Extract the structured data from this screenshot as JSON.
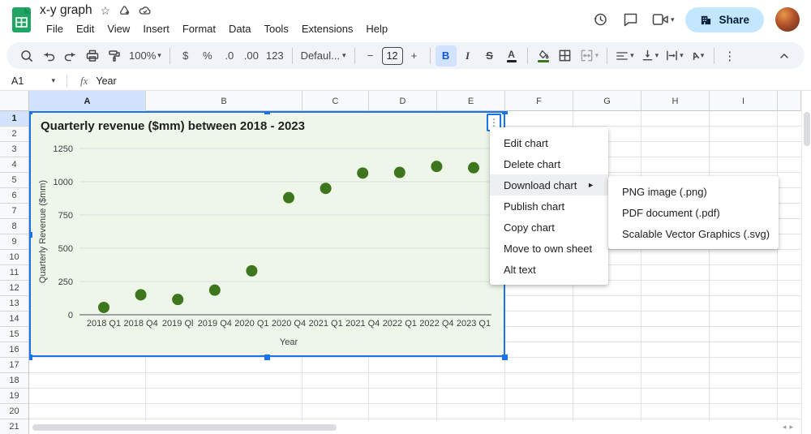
{
  "titlebar": {
    "title": "x-y graph",
    "menus": [
      "File",
      "Edit",
      "View",
      "Insert",
      "Format",
      "Data",
      "Tools",
      "Extensions",
      "Help"
    ],
    "share_label": "Share"
  },
  "toolbar": {
    "zoom": "100%",
    "currency": "$",
    "percent": "%",
    "decrease_decimal": ".0",
    "increase_decimal": ".00",
    "more_formats": "123",
    "font": "Defaul...",
    "font_size": "12",
    "decrease_font": "−",
    "increase_font": "+",
    "bold": "B",
    "italic": "I",
    "strikethrough": "S",
    "text_color": "A",
    "text_rotation": "A",
    "more": "⋮"
  },
  "formula_bar": {
    "name_box": "A1",
    "fx": "fx",
    "value": "Year"
  },
  "grid": {
    "columns": [
      "A",
      "B",
      "C",
      "D",
      "E",
      "F",
      "G",
      "H",
      "I"
    ],
    "selected_column": "A",
    "row_count": 21,
    "selected_row": "1"
  },
  "chart_data": {
    "type": "scatter",
    "title": "Quarterly revenue ($mm) between 2018 - 2023",
    "xlabel": "Year",
    "ylabel": "Quarterly Revenue ($mm)",
    "categories": [
      "2018 Q1",
      "2018 Q4",
      "2019 Ql",
      "2019 Q4",
      "2020 Q1",
      "2020 Q4",
      "2021 Q1",
      "2021 Q4",
      "2022 Q1",
      "2022 Q4",
      "2023 Q1"
    ],
    "values": [
      55,
      150,
      115,
      185,
      330,
      880,
      950,
      1065,
      1070,
      1115,
      1105
    ],
    "ylim": [
      0,
      1250
    ],
    "yticks": [
      0,
      250,
      500,
      750,
      1000,
      1250
    ],
    "grid": true,
    "legend": "none",
    "point_color": "#3e761d"
  },
  "menus": {
    "context": {
      "items": [
        {
          "label": "Edit chart"
        },
        {
          "label": "Delete chart"
        },
        {
          "label": "Download chart",
          "has_submenu": true,
          "highlighted": true
        },
        {
          "label": "Publish chart"
        },
        {
          "label": "Copy chart"
        },
        {
          "label": "Move to own sheet"
        },
        {
          "label": "Alt text"
        }
      ]
    },
    "download_submenu": {
      "items": [
        "PNG image (.png)",
        "PDF document (.pdf)",
        "Scalable Vector Graphics (.svg)"
      ]
    }
  },
  "colors": {
    "accent": "#1a73e8",
    "chart_background": "#eef6e9",
    "point": "#3e761d",
    "share_button": "#c2e7ff",
    "selected_header": "#d3e3fd"
  }
}
